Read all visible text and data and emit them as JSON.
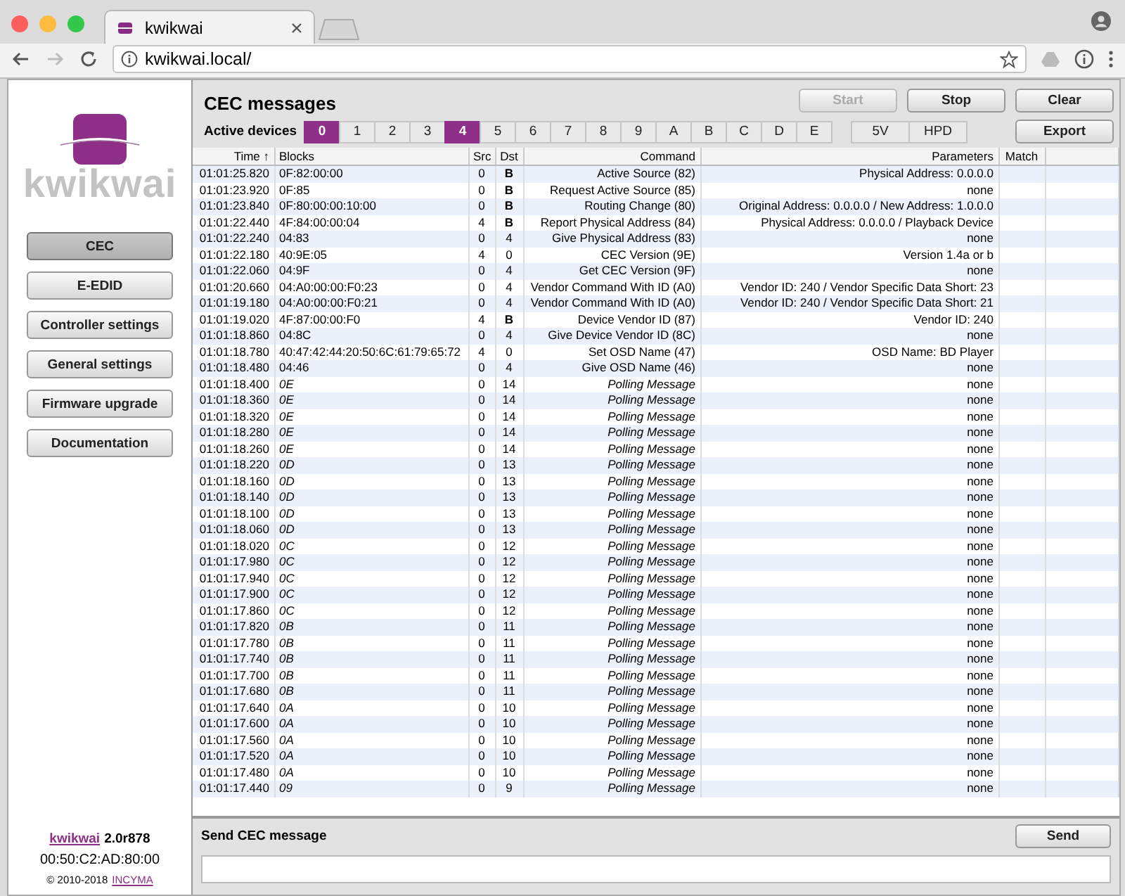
{
  "browser": {
    "tab_title": "kwikwai",
    "url": "kwikwai.local/"
  },
  "sidebar": {
    "logo_text": "kwikwai",
    "items": [
      {
        "label": "CEC",
        "selected": true
      },
      {
        "label": "E-EDID",
        "selected": false
      },
      {
        "label": "Controller settings",
        "selected": false
      },
      {
        "label": "General settings",
        "selected": false
      },
      {
        "label": "Firmware upgrade",
        "selected": false
      },
      {
        "label": "Documentation",
        "selected": false
      }
    ],
    "footer": {
      "product_link": "kwikwai",
      "version": "2.0r878",
      "mac": "00:50:C2:AD:80:00",
      "copyright": "© 2010-2018",
      "company_link": "INCYMA"
    }
  },
  "header": {
    "title": "CEC messages",
    "active_devices_label": "Active devices",
    "devices": [
      {
        "label": "0",
        "active": true
      },
      {
        "label": "1",
        "active": false
      },
      {
        "label": "2",
        "active": false
      },
      {
        "label": "3",
        "active": false
      },
      {
        "label": "4",
        "active": true
      },
      {
        "label": "5",
        "active": false
      },
      {
        "label": "6",
        "active": false
      },
      {
        "label": "7",
        "active": false
      },
      {
        "label": "8",
        "active": false
      },
      {
        "label": "9",
        "active": false
      },
      {
        "label": "A",
        "active": false
      },
      {
        "label": "B",
        "active": false
      },
      {
        "label": "C",
        "active": false
      },
      {
        "label": "D",
        "active": false
      },
      {
        "label": "E",
        "active": false
      }
    ],
    "signals": [
      "5V",
      "HPD"
    ],
    "buttons": [
      {
        "label": "Start",
        "disabled": true
      },
      {
        "label": "Stop",
        "disabled": false
      },
      {
        "label": "Clear",
        "disabled": false
      },
      {
        "label": "Export",
        "disabled": false
      }
    ]
  },
  "table": {
    "columns": [
      "Time ↑",
      "Blocks",
      "Src",
      "Dst",
      "Command",
      "Parameters",
      "Match"
    ],
    "rows": [
      {
        "kind": "message",
        "time": "01:01:25.820",
        "blocks": "0F:82:00:00",
        "src": "0",
        "dst": "B",
        "broadcast": true,
        "command": "Active Source (82)",
        "parameters": "Physical Address: 0.0.0.0"
      },
      {
        "kind": "message",
        "time": "01:01:23.920",
        "blocks": "0F:85",
        "src": "0",
        "dst": "B",
        "broadcast": true,
        "command": "Request Active Source (85)",
        "parameters": "none"
      },
      {
        "kind": "message",
        "time": "01:01:23.840",
        "blocks": "0F:80:00:00:10:00",
        "src": "0",
        "dst": "B",
        "broadcast": true,
        "command": "Routing Change (80)",
        "parameters": "Original Address: 0.0.0.0 / New Address: 1.0.0.0"
      },
      {
        "kind": "message",
        "time": "01:01:22.440",
        "blocks": "4F:84:00:00:04",
        "src": "4",
        "dst": "B",
        "broadcast": true,
        "command": "Report Physical Address (84)",
        "parameters": "Physical Address: 0.0.0.0 / Playback Device"
      },
      {
        "kind": "message",
        "time": "01:01:22.240",
        "blocks": "04:83",
        "src": "0",
        "dst": "4",
        "broadcast": false,
        "command": "Give Physical Address (83)",
        "parameters": "none"
      },
      {
        "kind": "message",
        "time": "01:01:22.180",
        "blocks": "40:9E:05",
        "src": "4",
        "dst": "0",
        "broadcast": false,
        "command": "CEC Version (9E)",
        "parameters": "Version 1.4a or b"
      },
      {
        "kind": "message",
        "time": "01:01:22.060",
        "blocks": "04:9F",
        "src": "0",
        "dst": "4",
        "broadcast": false,
        "command": "Get CEC Version (9F)",
        "parameters": "none"
      },
      {
        "kind": "message",
        "time": "01:01:20.660",
        "blocks": "04:A0:00:00:F0:23",
        "src": "0",
        "dst": "4",
        "broadcast": false,
        "command": "Vendor Command With ID (A0)",
        "parameters": "Vendor ID: 240 / Vendor Specific Data Short: 23"
      },
      {
        "kind": "message",
        "time": "01:01:19.180",
        "blocks": "04:A0:00:00:F0:21",
        "src": "0",
        "dst": "4",
        "broadcast": false,
        "command": "Vendor Command With ID (A0)",
        "parameters": "Vendor ID: 240 / Vendor Specific Data Short: 21"
      },
      {
        "kind": "message",
        "time": "01:01:19.020",
        "blocks": "4F:87:00:00:F0",
        "src": "4",
        "dst": "B",
        "broadcast": true,
        "command": "Device Vendor ID (87)",
        "parameters": "Vendor ID: 240"
      },
      {
        "kind": "message",
        "time": "01:01:18.860",
        "blocks": "04:8C",
        "src": "0",
        "dst": "4",
        "broadcast": false,
        "command": "Give Device Vendor ID (8C)",
        "parameters": "none"
      },
      {
        "kind": "message",
        "time": "01:01:18.780",
        "blocks": "40:47:42:44:20:50:6C:61:79:65:72",
        "src": "4",
        "dst": "0",
        "broadcast": false,
        "command": "Set OSD Name (47)",
        "parameters": "OSD Name: BD Player"
      },
      {
        "kind": "message",
        "time": "01:01:18.480",
        "blocks": "04:46",
        "src": "0",
        "dst": "4",
        "broadcast": false,
        "command": "Give OSD Name (46)",
        "parameters": "none"
      },
      {
        "kind": "polling",
        "time": "01:01:18.400",
        "blocks": "0E",
        "src": "0",
        "dst": "14",
        "broadcast": false,
        "command": "Polling Message",
        "parameters": "none"
      },
      {
        "kind": "polling",
        "time": "01:01:18.360",
        "blocks": "0E",
        "src": "0",
        "dst": "14",
        "broadcast": false,
        "command": "Polling Message",
        "parameters": "none"
      },
      {
        "kind": "polling",
        "time": "01:01:18.320",
        "blocks": "0E",
        "src": "0",
        "dst": "14",
        "broadcast": false,
        "command": "Polling Message",
        "parameters": "none"
      },
      {
        "kind": "polling",
        "time": "01:01:18.280",
        "blocks": "0E",
        "src": "0",
        "dst": "14",
        "broadcast": false,
        "command": "Polling Message",
        "parameters": "none"
      },
      {
        "kind": "polling",
        "time": "01:01:18.260",
        "blocks": "0E",
        "src": "0",
        "dst": "14",
        "broadcast": false,
        "command": "Polling Message",
        "parameters": "none"
      },
      {
        "kind": "polling",
        "time": "01:01:18.220",
        "blocks": "0D",
        "src": "0",
        "dst": "13",
        "broadcast": false,
        "command": "Polling Message",
        "parameters": "none"
      },
      {
        "kind": "polling",
        "time": "01:01:18.160",
        "blocks": "0D",
        "src": "0",
        "dst": "13",
        "broadcast": false,
        "command": "Polling Message",
        "parameters": "none"
      },
      {
        "kind": "polling",
        "time": "01:01:18.140",
        "blocks": "0D",
        "src": "0",
        "dst": "13",
        "broadcast": false,
        "command": "Polling Message",
        "parameters": "none"
      },
      {
        "kind": "polling",
        "time": "01:01:18.100",
        "blocks": "0D",
        "src": "0",
        "dst": "13",
        "broadcast": false,
        "command": "Polling Message",
        "parameters": "none"
      },
      {
        "kind": "polling",
        "time": "01:01:18.060",
        "blocks": "0D",
        "src": "0",
        "dst": "13",
        "broadcast": false,
        "command": "Polling Message",
        "parameters": "none"
      },
      {
        "kind": "polling",
        "time": "01:01:18.020",
        "blocks": "0C",
        "src": "0",
        "dst": "12",
        "broadcast": false,
        "command": "Polling Message",
        "parameters": "none"
      },
      {
        "kind": "polling",
        "time": "01:01:17.980",
        "blocks": "0C",
        "src": "0",
        "dst": "12",
        "broadcast": false,
        "command": "Polling Message",
        "parameters": "none"
      },
      {
        "kind": "polling",
        "time": "01:01:17.940",
        "blocks": "0C",
        "src": "0",
        "dst": "12",
        "broadcast": false,
        "command": "Polling Message",
        "parameters": "none"
      },
      {
        "kind": "polling",
        "time": "01:01:17.900",
        "blocks": "0C",
        "src": "0",
        "dst": "12",
        "broadcast": false,
        "command": "Polling Message",
        "parameters": "none"
      },
      {
        "kind": "polling",
        "time": "01:01:17.860",
        "blocks": "0C",
        "src": "0",
        "dst": "12",
        "broadcast": false,
        "command": "Polling Message",
        "parameters": "none"
      },
      {
        "kind": "polling",
        "time": "01:01:17.820",
        "blocks": "0B",
        "src": "0",
        "dst": "11",
        "broadcast": false,
        "command": "Polling Message",
        "parameters": "none"
      },
      {
        "kind": "polling",
        "time": "01:01:17.780",
        "blocks": "0B",
        "src": "0",
        "dst": "11",
        "broadcast": false,
        "command": "Polling Message",
        "parameters": "none"
      },
      {
        "kind": "polling",
        "time": "01:01:17.740",
        "blocks": "0B",
        "src": "0",
        "dst": "11",
        "broadcast": false,
        "command": "Polling Message",
        "parameters": "none"
      },
      {
        "kind": "polling",
        "time": "01:01:17.700",
        "blocks": "0B",
        "src": "0",
        "dst": "11",
        "broadcast": false,
        "command": "Polling Message",
        "parameters": "none"
      },
      {
        "kind": "polling",
        "time": "01:01:17.680",
        "blocks": "0B",
        "src": "0",
        "dst": "11",
        "broadcast": false,
        "command": "Polling Message",
        "parameters": "none"
      },
      {
        "kind": "polling",
        "time": "01:01:17.640",
        "blocks": "0A",
        "src": "0",
        "dst": "10",
        "broadcast": false,
        "command": "Polling Message",
        "parameters": "none"
      },
      {
        "kind": "polling",
        "time": "01:01:17.600",
        "blocks": "0A",
        "src": "0",
        "dst": "10",
        "broadcast": false,
        "command": "Polling Message",
        "parameters": "none"
      },
      {
        "kind": "polling",
        "time": "01:01:17.560",
        "blocks": "0A",
        "src": "0",
        "dst": "10",
        "broadcast": false,
        "command": "Polling Message",
        "parameters": "none"
      },
      {
        "kind": "polling",
        "time": "01:01:17.520",
        "blocks": "0A",
        "src": "0",
        "dst": "10",
        "broadcast": false,
        "command": "Polling Message",
        "parameters": "none"
      },
      {
        "kind": "polling",
        "time": "01:01:17.480",
        "blocks": "0A",
        "src": "0",
        "dst": "10",
        "broadcast": false,
        "command": "Polling Message",
        "parameters": "none"
      },
      {
        "kind": "polling",
        "time": "01:01:17.440",
        "blocks": "09",
        "src": "0",
        "dst": "9",
        "broadcast": false,
        "command": "Polling Message",
        "parameters": "none"
      }
    ]
  },
  "send": {
    "label": "Send CEC message",
    "button": "Send"
  }
}
